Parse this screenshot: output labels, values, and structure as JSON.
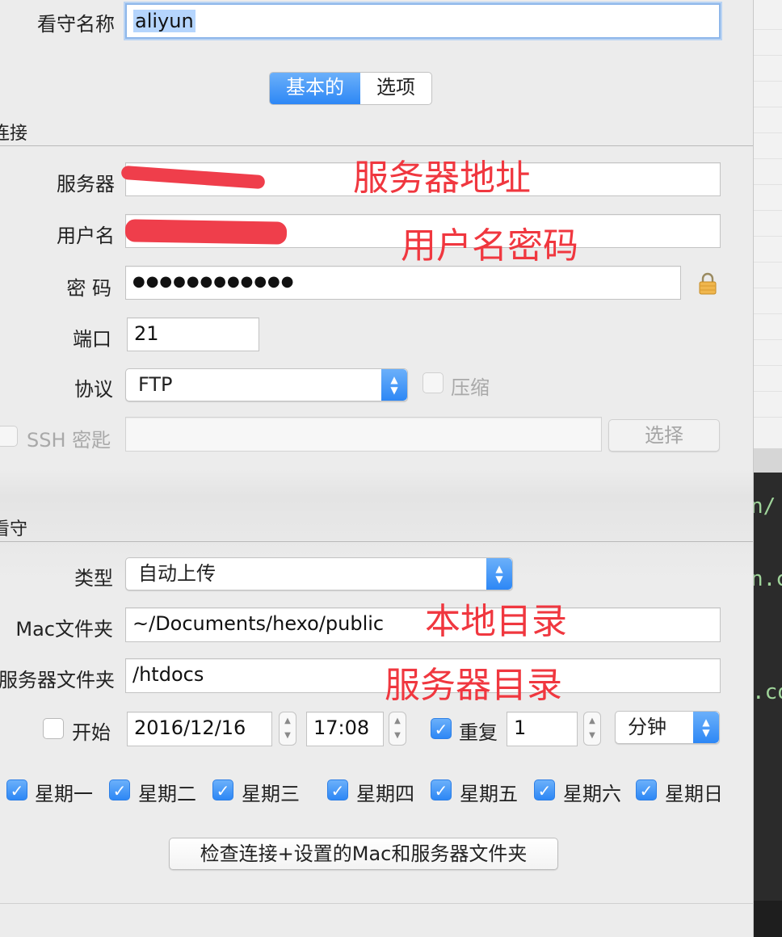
{
  "watch_name": {
    "label": "看守名称",
    "value": "aliyun"
  },
  "tabs": [
    {
      "label": "基本的",
      "active": true
    },
    {
      "label": "选项",
      "active": false
    }
  ],
  "connection": {
    "section_title": "连接",
    "server": {
      "label": "服务器",
      "value": ""
    },
    "username": {
      "label": "用户名",
      "value": ""
    },
    "password": {
      "label": "密 码",
      "value": "●●●●●●●●●●●●"
    },
    "port": {
      "label": "端口",
      "value": "21"
    },
    "protocol": {
      "label": "协议",
      "value": "FTP"
    },
    "compress": {
      "label": "压缩",
      "checked": false,
      "enabled": false
    },
    "ssh_key": {
      "label": "SSH 密匙",
      "checked": false,
      "enabled": false,
      "value": ""
    },
    "choose_button": "选择"
  },
  "watch": {
    "section_title": "看守",
    "type": {
      "label": "类型",
      "value": "自动上传"
    },
    "mac_folder": {
      "label": "Mac文件夹",
      "value": "~/Documents/hexo/public"
    },
    "server_folder": {
      "label": "服务器文件夹",
      "value": "/htdocs"
    },
    "start": {
      "label": "开始",
      "checked": false,
      "date": "2016/12/16",
      "time": "17:08"
    },
    "repeat": {
      "label": "重复",
      "checked": true,
      "count": "1",
      "unit": "分钟"
    },
    "weekdays": [
      {
        "label": "星期一",
        "checked": true
      },
      {
        "label": "星期二",
        "checked": true
      },
      {
        "label": "星期三",
        "checked": true
      },
      {
        "label": "星期四",
        "checked": true
      },
      {
        "label": "星期五",
        "checked": true
      },
      {
        "label": "星期六",
        "checked": true
      },
      {
        "label": "星期日",
        "checked": true
      }
    ],
    "check_button": "检查连接+设置的Mac和服务器文件夹"
  },
  "annotations": {
    "server_address": "服务器地址",
    "user_password": "用户名密码",
    "local_dir": "本地目录",
    "server_dir": "服务器目录"
  },
  "background_terminal": [
    "n/",
    "n.c",
    ".co"
  ],
  "colors": {
    "accent": "#2d87f5",
    "annotation": "#f0373f",
    "redaction": "#ef3e4b"
  }
}
